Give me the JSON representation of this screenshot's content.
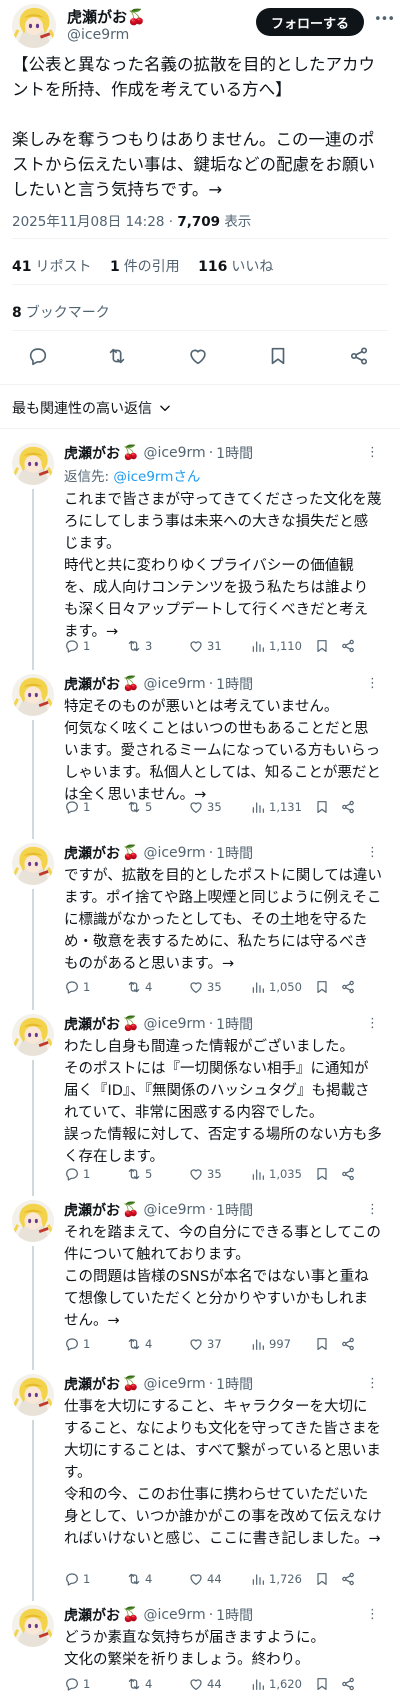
{
  "author": {
    "name": "虎瀬がお",
    "handle": "@ice9rm",
    "cherry": "🍒"
  },
  "follow_label": "フォローする",
  "main_post": {
    "text": "【公表と異なった名義の拡散を目的としたアカウントを所持、作成を考えている方へ】\n\n楽しみを奪うつもりはありません。この一連のポストから伝えたい事は、鍵垢などの配慮をお願いしたいと言う気持ちです。→",
    "timestamp": "2025年11月08日 14:28",
    "separator": "·",
    "views_count": "7,709",
    "views_label": "表示",
    "reposts_count": "41",
    "reposts_label": "リポスト",
    "quotes_count": "1",
    "quotes_label": "件の引用",
    "likes_count": "116",
    "likes_label": "いいね",
    "bookmarks_count": "8",
    "bookmarks_label": "ブックマーク"
  },
  "sort_label": "最も関連性の高い返信",
  "replies": [
    {
      "time": "1時間",
      "reply_to_label": "返信先:",
      "reply_to_handle": "@ice9rmさん",
      "text": "これまで皆さまが守ってきてくださった文化を蔑ろにしてしまう事は未来への大きな損失だと感じます。\n時代と共に変わりゆくプライバシーの価値観を、成人向けコンテンツを扱う私たちは誰よりも深く日々アップデートして行くべきだと考えます。→",
      "replies": "1",
      "reposts": "3",
      "likes": "31",
      "views": "1,110"
    },
    {
      "time": "1時間",
      "text": "特定そのものが悪いとは考えていません。\n何気なく呟くことはいつの世もあることだと思います。愛されるミームになっている方もいらっしゃいます。私個人としては、知ることが悪だとは全く思いません。→",
      "replies": "1",
      "reposts": "5",
      "likes": "35",
      "views": "1,131"
    },
    {
      "time": "1時間",
      "text": "ですが、拡散を目的としたポストに関しては違います。ポイ捨てや路上喫煙と同じように例えそこに標識がなかったとしても、その土地を守るため・敬意を表するために、私たちには守るべきものがあると思います。→",
      "replies": "1",
      "reposts": "4",
      "likes": "35",
      "views": "1,050"
    },
    {
      "time": "1時間",
      "text": "わたし自身も間違った情報がございました。\nそのポストには『一切関係ない相手』に通知が届く『ID』、『無関係のハッシュタグ』も掲載されていて、非常に困惑する内容でした。\n誤った情報に対して、否定する場所のない方も多く存在します。",
      "replies": "1",
      "reposts": "5",
      "likes": "35",
      "views": "1,035"
    },
    {
      "time": "1時間",
      "text": "それを踏まえて、今の自分にできる事としてこの件について触れております。\nこの問題は皆様のSNSが本名ではない事と重ねて想像していただくと分かりやすいかもしれません。→",
      "replies": "1",
      "reposts": "4",
      "likes": "37",
      "views": "997"
    },
    {
      "time": "1時間",
      "text": "仕事を大切にすること、キャラクターを大切にすること、なによりも文化を守ってきた皆さまを大切にすることは、すべて繋がっていると思います。\n令和の今、このお仕事に携わらせていただいた身として、いつか誰かがこの事を改めて伝えなければいけないと感じ、ここに書き記しました。→",
      "replies": "1",
      "reposts": "4",
      "likes": "44",
      "views": "1,726"
    },
    {
      "time": "1時間",
      "text": "どうか素直な気持ちが届きますように。\n文化の繁栄を祈りましょう。終わり。",
      "replies": "1",
      "reposts": "4",
      "likes": "44",
      "views": "1,620"
    }
  ],
  "icons": {
    "reply": "reply-icon",
    "repost": "repost-icon",
    "like": "like-icon",
    "views": "views-icon",
    "bookmark": "bookmark-icon",
    "share": "share-icon"
  },
  "colors": {
    "text": "#0f1419",
    "secondary": "#536471",
    "link": "#1d9bf0",
    "divider": "#eff3f4",
    "follow_bg": "#0f1419"
  }
}
